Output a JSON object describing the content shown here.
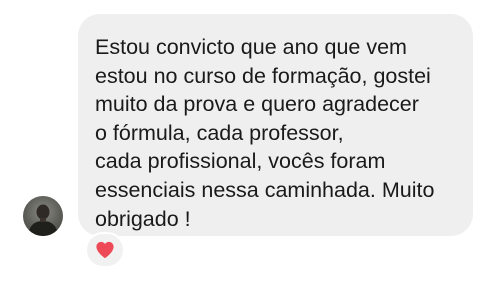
{
  "message": {
    "text": "Estou convicto que ano que vem\nestou no curso de formação, gostei\nmuito da prova e quero agradecer\no fórmula, cada professor,\ncada profissional, vocês foram\nessenciais nessa caminhada. Muito\nobrigado !"
  },
  "avatar": {
    "icon": "person-photo"
  },
  "reaction": {
    "icon": "heart-icon",
    "color": "#ed4956"
  },
  "colors": {
    "bubble": "#efefef",
    "text": "#1a1a1a"
  }
}
